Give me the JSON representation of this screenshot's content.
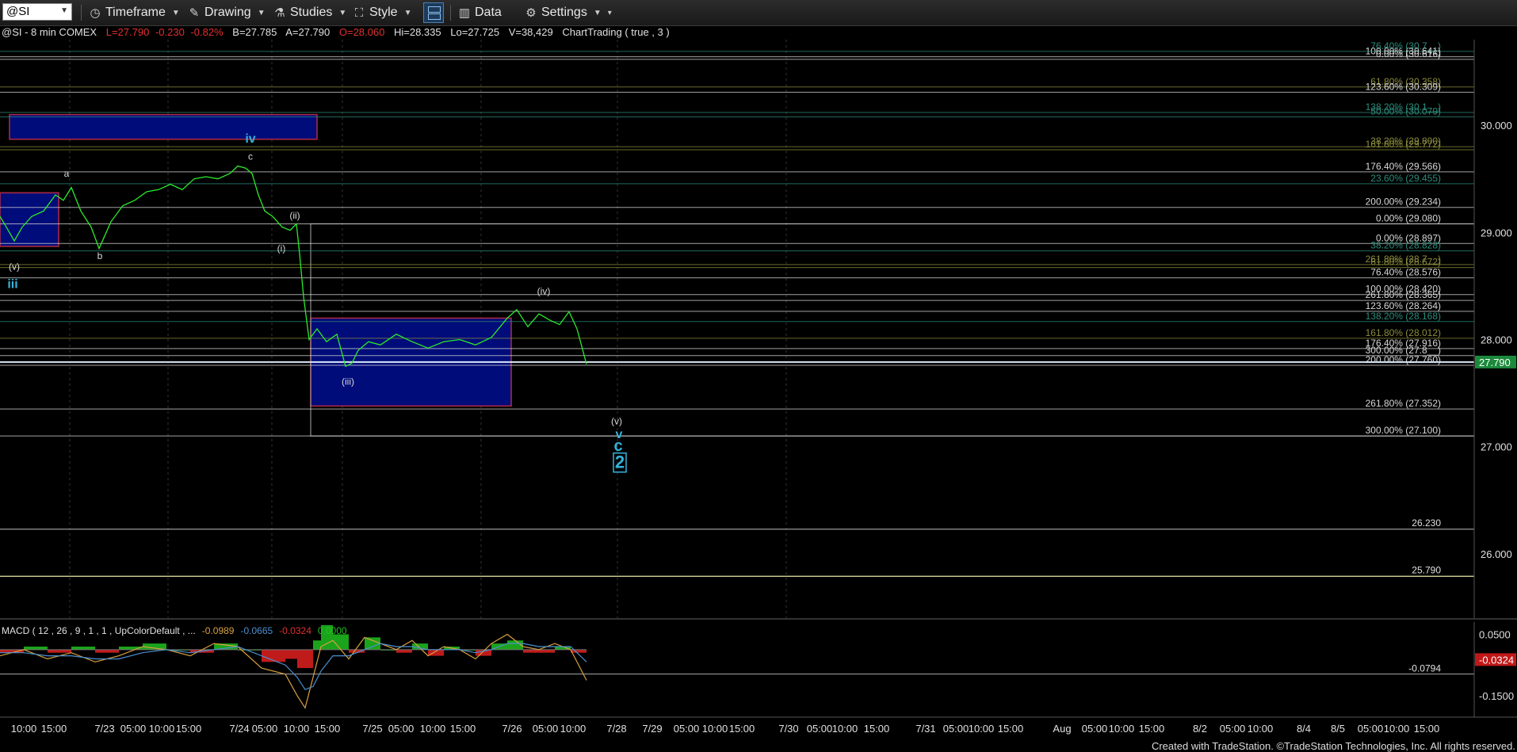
{
  "toolbar": {
    "symbol": "@SI",
    "timeframe": "Timeframe",
    "drawing": "Drawing",
    "studies": "Studies",
    "style": "Style",
    "data": "Data",
    "settings": "Settings"
  },
  "header": {
    "symbol_info": "@SI - 8 min  COMEX",
    "last": "L=27.790",
    "change": "-0.230",
    "change_pct": "-0.82%",
    "bid": "B=27.785",
    "ask": "A=27.790",
    "open": "O=28.060",
    "high": "Hi=28.335",
    "low": "Lo=27.725",
    "volume": "V=38,429",
    "study_info": "ChartTrading ( true , 3 )"
  },
  "colors": {
    "price_line": "#2bea2b",
    "box_fill": "#000c7a",
    "box_border": "#b02a48",
    "wave_label": "#34b4dc",
    "fib_green": "#2c8c7c",
    "fib_olive": "#8c8c3c",
    "fib_white": "#d8d8d8",
    "last_price_bg": "#1c8a3c",
    "macd_neg": "#e02020",
    "macd_pos": "#20c020",
    "macd_line": "#d8a040",
    "signal_line": "#4a90d0"
  },
  "chart_data": [
    {
      "type": "line",
      "ylim": [
        25.4,
        30.8
      ],
      "y_ticks": [
        30.0,
        29.0,
        28.0,
        27.0,
        26.0
      ],
      "y_tick_labels": [
        "30.000",
        "29.000",
        "28.000",
        "27.000",
        "26.000"
      ],
      "x_tick_labels": [
        "10:00",
        "15:00",
        "7/23",
        "05:00",
        "10:00",
        "15:00",
        "7/24",
        "05:00",
        "10:00",
        "15:00",
        "7/25",
        "05:00",
        "10:00",
        "15:00",
        "7/26",
        "05:00",
        "10:00",
        "7/28",
        "7/29",
        "05:00",
        "10:00",
        "15:00",
        "7/30",
        "05:00",
        "10:00",
        "15:00",
        "7/31",
        "05:00",
        "10:00",
        "15:00",
        "Aug",
        "05:00",
        "10:00",
        "15:00",
        "8/2",
        "05:00",
        "10:00",
        "8/4",
        "8/5",
        "05:00",
        "10:00",
        "15:00"
      ],
      "last_price": 27.79,
      "last_price_label": "27.790",
      "series": [
        {
          "x": [
            0,
            8,
            18,
            28,
            40,
            55,
            70,
            80,
            90,
            102,
            115,
            125,
            140,
            155,
            170,
            185,
            200,
            215,
            230,
            245,
            260,
            275,
            290,
            300,
            310,
            318,
            326,
            334,
            344,
            356,
            366,
            374,
            378,
            383,
            390,
            400,
            412,
            425,
            436,
            444,
            452,
            465,
            480,
            500,
            520,
            540,
            560,
            580,
            600,
            620,
            640,
            652,
            666,
            680,
            694,
            706,
            718,
            728,
            740
          ],
          "y": [
            29.15,
            29.05,
            28.92,
            29.05,
            29.15,
            29.2,
            29.35,
            29.3,
            29.42,
            29.2,
            29.05,
            28.85,
            29.1,
            29.25,
            29.3,
            29.38,
            29.4,
            29.45,
            29.4,
            29.5,
            29.52,
            29.5,
            29.55,
            29.62,
            29.6,
            29.55,
            29.35,
            29.2,
            29.15,
            29.05,
            29.02,
            29.08,
            28.8,
            28.4,
            28.0,
            28.1,
            27.98,
            28.05,
            27.75,
            27.78,
            27.9,
            27.98,
            27.95,
            28.05,
            27.98,
            27.92,
            27.98,
            28.0,
            27.95,
            28.02,
            28.2,
            28.28,
            28.12,
            28.24,
            28.18,
            28.14,
            28.26,
            28.1,
            27.77
          ]
        }
      ],
      "boxes": [
        {
          "x0": 12,
          "x1": 400,
          "y0": 30.1,
          "y1": 29.87
        },
        {
          "x0": 0,
          "x1": 74,
          "y0": 29.37,
          "y1": 28.87
        },
        {
          "x0": 392,
          "x1": 645,
          "y0": 28.2,
          "y1": 27.38
        }
      ],
      "fib_levels": [
        {
          "pct": "100.00%",
          "value": 30.64,
          "label": "100.00% (30.641)",
          "color": "white"
        },
        {
          "pct": "76.40%",
          "value": 30.69,
          "label": "76.40% (30.7__)",
          "color": "green"
        },
        {
          "pct": "0.00%",
          "value": 30.616,
          "label": "0.00% (30.616)",
          "color": "white"
        },
        {
          "pct": "61.80%",
          "value": 30.358,
          "label": "61.80% (30.358)",
          "color": "olive"
        },
        {
          "pct": "123.60%",
          "value": 30.309,
          "label": "123.60% (30.309)",
          "color": "white"
        },
        {
          "pct": "138.20%",
          "value": 30.12,
          "label": "138.20% (30.1__)",
          "color": "green"
        },
        {
          "pct": "50.00%",
          "value": 30.079,
          "label": "50.00% (30.079)",
          "color": "green"
        },
        {
          "pct": "38.20%",
          "value": 29.8,
          "label": "38.20% (29.800)",
          "color": "olive"
        },
        {
          "pct": "161.80%",
          "value": 29.772,
          "label": "161.80% (29.772)",
          "color": "olive"
        },
        {
          "pct": "176.40%",
          "value": 29.566,
          "label": "176.40% (29.566)",
          "color": "white"
        },
        {
          "pct": "23.60%",
          "value": 29.455,
          "label": "23.60% (29.455)",
          "color": "green"
        },
        {
          "pct": "200.00%",
          "value": 29.234,
          "label": "200.00% (29.234)",
          "color": "white"
        },
        {
          "pct": "0.00%",
          "value": 29.08,
          "label": "0.00% (29.080)",
          "color": "white"
        },
        {
          "pct": "0.00%",
          "value": 28.897,
          "label": "0.00% (28.897)",
          "color": "white"
        },
        {
          "pct": "38.20%",
          "value": 28.828,
          "label": "38.20% (28.828)",
          "color": "green"
        },
        {
          "pct": "261.80%",
          "value": 28.7,
          "label": "261.80% (28.7__)",
          "color": "olive"
        },
        {
          "pct": "61.80%",
          "value": 28.672,
          "label": "61.80% (28.672)",
          "color": "olive"
        },
        {
          "pct": "76.40%",
          "value": 28.576,
          "label": "76.40% (28.576)",
          "color": "white"
        },
        {
          "pct": "100.00%",
          "value": 28.42,
          "label": "100.00% (28.420)",
          "color": "white"
        },
        {
          "pct": "261.80%",
          "value": 28.365,
          "label": "261.80% (28.365)",
          "color": "white"
        },
        {
          "pct": "123.60%",
          "value": 28.264,
          "label": "123.60% (28.264)",
          "color": "white"
        },
        {
          "pct": "138.20%",
          "value": 28.168,
          "label": "138.20% (28.168)",
          "color": "green"
        },
        {
          "pct": "161.80%",
          "value": 28.012,
          "label": "161.80% (28.012)",
          "color": "olive"
        },
        {
          "pct": "176.40%",
          "value": 27.916,
          "label": "176.40% (27.916)",
          "color": "white"
        },
        {
          "pct": "300.00%",
          "value": 27.85,
          "label": "300.00% (27.8__)",
          "color": "white"
        },
        {
          "pct": "200.00%",
          "value": 27.76,
          "label": "200.00% (27.760)",
          "color": "white"
        },
        {
          "pct": "261.80%",
          "value": 27.352,
          "label": "261.80% (27.352)",
          "color": "white"
        },
        {
          "pct": "300.00%",
          "value": 27.1,
          "label": "300.00% (27.100)",
          "color": "white"
        }
      ],
      "price_levels": [
        {
          "value": 26.23,
          "label": "26.230"
        },
        {
          "value": 25.79,
          "label": "25.790"
        }
      ],
      "wave_labels": [
        {
          "text": "iv",
          "x": 316,
          "y": 29.84,
          "style": "cyan-bold"
        },
        {
          "text": "c",
          "x": 316,
          "y": 29.68,
          "style": "white"
        },
        {
          "text": "a",
          "x": 84,
          "y": 29.52,
          "style": "white"
        },
        {
          "text": "b",
          "x": 126,
          "y": 28.75,
          "style": "white"
        },
        {
          "text": "(ii)",
          "x": 372,
          "y": 29.13,
          "style": "white"
        },
        {
          "text": "(i)",
          "x": 355,
          "y": 28.82,
          "style": "white"
        },
        {
          "text": "(v)",
          "x": 18,
          "y": 28.65,
          "style": "white"
        },
        {
          "text": "iii",
          "x": 16,
          "y": 28.48,
          "style": "cyan-bold"
        },
        {
          "text": "(iv)",
          "x": 686,
          "y": 28.42,
          "style": "white"
        },
        {
          "text": "(iii)",
          "x": 439,
          "y": 27.58,
          "style": "white"
        },
        {
          "text": "(v)",
          "x": 778,
          "y": 27.21,
          "style": "white"
        },
        {
          "text": "v",
          "x": 781,
          "y": 27.08,
          "style": "cyan-bold"
        },
        {
          "text": "c",
          "x": 780,
          "y": 26.96,
          "style": "cyan-big"
        },
        {
          "text": "2",
          "x": 782,
          "y": 26.8,
          "style": "cyan-boxed"
        }
      ]
    },
    {
      "type": "bar",
      "title": "MACD ( 12 , 26 , 9 , 1 , 1 , UpColorDefault , ...",
      "legend": [
        "-0.0989",
        "-0.0665",
        "-0.0324",
        "0.0000"
      ],
      "ylim": [
        -0.22,
        0.09
      ],
      "y_ticks": [
        0.05,
        -0.15
      ],
      "y_tick_labels": [
        "0.0500",
        "-0.1500"
      ],
      "level": {
        "value": -0.0794,
        "label": "-0.0794"
      },
      "last_value_label": "-0.0324",
      "x": [
        0,
        30,
        60,
        90,
        120,
        150,
        180,
        210,
        240,
        270,
        300,
        330,
        360,
        375,
        385,
        395,
        405,
        420,
        440,
        460,
        480,
        500,
        520,
        540,
        560,
        580,
        600,
        620,
        640,
        660,
        680,
        700,
        720,
        740
      ],
      "macd": [
        -0.02,
        0.0,
        -0.03,
        -0.01,
        -0.04,
        -0.02,
        0.01,
        0.0,
        -0.02,
        0.02,
        0.01,
        -0.06,
        -0.08,
        -0.15,
        -0.19,
        -0.09,
        0.01,
        0.03,
        -0.03,
        0.04,
        0.02,
        0.0,
        0.03,
        -0.02,
        0.01,
        0.0,
        -0.03,
        0.02,
        0.05,
        0.01,
        0.0,
        0.02,
        0.0,
        -0.1
      ],
      "signal": [
        -0.01,
        -0.01,
        -0.02,
        -0.02,
        -0.03,
        -0.03,
        -0.01,
        0.0,
        -0.01,
        0.0,
        0.01,
        -0.02,
        -0.05,
        -0.09,
        -0.13,
        -0.12,
        -0.07,
        -0.02,
        -0.02,
        0.0,
        0.02,
        0.01,
        0.01,
        0.0,
        0.0,
        0.0,
        -0.01,
        0.0,
        0.02,
        0.02,
        0.01,
        0.01,
        0.01,
        -0.04
      ],
      "histogram": [
        -0.01,
        0.01,
        -0.01,
        0.01,
        -0.01,
        0.01,
        0.02,
        0.0,
        -0.01,
        0.02,
        0.0,
        -0.04,
        -0.03,
        -0.06,
        -0.06,
        0.03,
        0.08,
        0.05,
        -0.01,
        0.04,
        0.0,
        -0.01,
        0.02,
        -0.02,
        0.01,
        0.0,
        -0.02,
        0.02,
        0.03,
        -0.01,
        -0.01,
        0.01,
        -0.01,
        -0.06
      ]
    }
  ],
  "footer": "Created with TradeStation. ©TradeStation Technologies, Inc. All rights reserved."
}
